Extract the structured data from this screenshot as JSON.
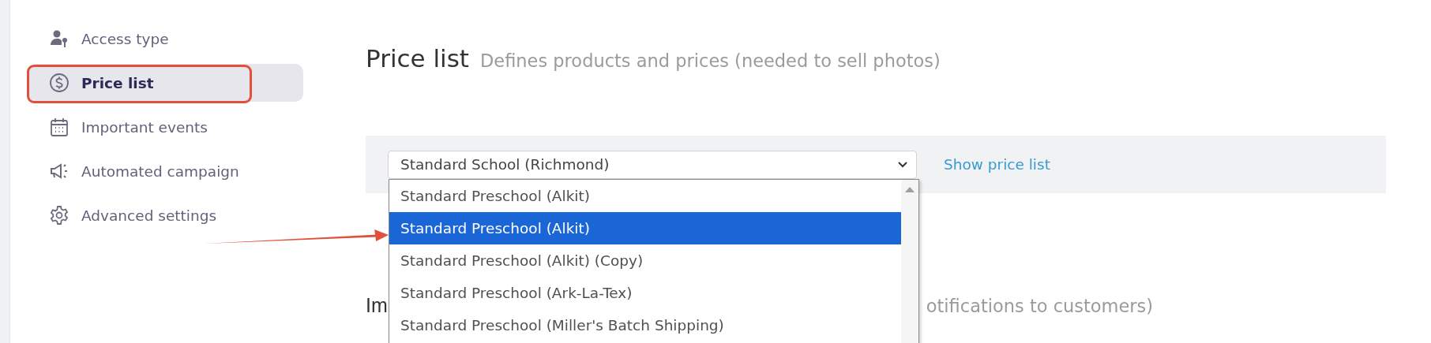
{
  "sidebar": {
    "items": [
      {
        "label": "Access type",
        "selected": false
      },
      {
        "label": "Price list",
        "selected": true
      },
      {
        "label": "Important events",
        "selected": false
      },
      {
        "label": "Automated campaign",
        "selected": false
      },
      {
        "label": "Advanced settings",
        "selected": false
      }
    ]
  },
  "section": {
    "title": "Price list",
    "subtitle": "Defines products and prices (needed to sell photos)"
  },
  "price_list_select": {
    "value": "Standard School (Richmond)",
    "link": "Show price list",
    "options": [
      {
        "label": "Standard Preschool (Alkit)",
        "selected": false
      },
      {
        "label": "Standard Preschool (Alkit)",
        "selected": true
      },
      {
        "label": "Standard Preschool (Alkit) (Copy)",
        "selected": false
      },
      {
        "label": "Standard Preschool (Ark-La-Tex)",
        "selected": false
      },
      {
        "label": "Standard Preschool (Miller's Batch Shipping)",
        "selected": false
      }
    ]
  },
  "next_section": {
    "title": "Im",
    "subtitle": "otifications to customers)"
  }
}
